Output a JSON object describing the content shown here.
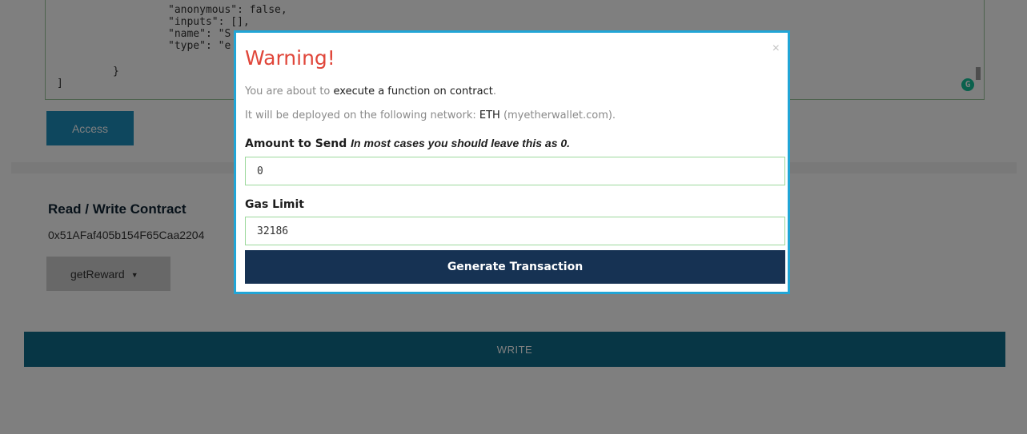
{
  "json_editor": {
    "lines": [
      "\"anonymous\": false,",
      "\"inputs\": [],",
      "\"name\": \"S",
      "\"type\": \"e",
      "}",
      "]"
    ]
  },
  "access_label": "Access",
  "read_write": {
    "title": "Read / Write Contract",
    "address": "0x51AFaf405b154F65Caa2204",
    "function_selected": "getReward",
    "write_label": "WRITE"
  },
  "modal": {
    "title": "Warning!",
    "close_symbol": "×",
    "line1_prefix": "You are about to ",
    "line1_strong": "execute a function on contract",
    "line1_suffix": ".",
    "line2_prefix": "It will be deployed on the following network: ",
    "line2_strong": "ETH",
    "line2_suffix": " (myetherwallet.com).",
    "amount_label": "Amount to Send",
    "amount_hint": "In most cases you should leave this as 0.",
    "amount_value": "0",
    "gas_label": "Gas Limit",
    "gas_value": "32186",
    "generate_label": "Generate Transaction"
  },
  "colors": {
    "accent": "#21a5d6",
    "warning": "#e0463a",
    "primary_dark": "#163253",
    "write_bar": "#0e6c8a"
  }
}
